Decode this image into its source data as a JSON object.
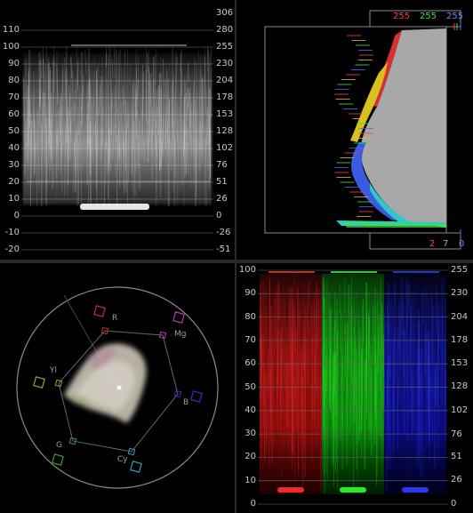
{
  "waveform": {
    "left_ticks": [
      "110",
      "100",
      "90",
      "80",
      "70",
      "60",
      "50",
      "40",
      "30",
      "20",
      "10",
      "0",
      "-10",
      "-20"
    ],
    "right_ticks": [
      "306",
      "280",
      "255",
      "230",
      "204",
      "178",
      "153",
      "128",
      "102",
      "76",
      "51",
      "26",
      "0",
      "-26",
      "-51"
    ]
  },
  "histogram": {
    "top_values": {
      "red": "255",
      "green": "255",
      "blue": "255"
    },
    "bottom_values": {
      "red": "2",
      "green": "7",
      "blue": "0"
    }
  },
  "vectorscope": {
    "targets": [
      "R",
      "Mg",
      "B",
      "Cy",
      "G",
      "Yl"
    ]
  },
  "parade": {
    "left_ticks": [
      "100",
      "90",
      "80",
      "70",
      "60",
      "50",
      "40",
      "30",
      "20",
      "10",
      "0"
    ],
    "right_ticks": [
      "255",
      "230",
      "204",
      "178",
      "153",
      "128",
      "102",
      "76",
      "51",
      "26",
      "0"
    ]
  },
  "colors": {
    "red": "#ff4040",
    "green": "#40e040",
    "blue": "#4a6aff",
    "grid": "#5a5a5a",
    "panel_bg": "#000000",
    "app_bg": "#2a2a2a"
  }
}
